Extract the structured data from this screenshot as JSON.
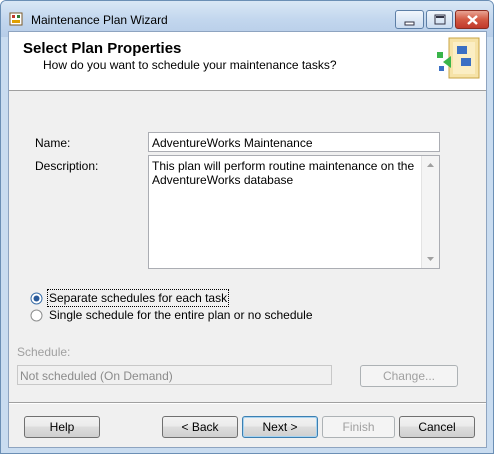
{
  "window": {
    "title": "Maintenance Plan Wizard"
  },
  "header": {
    "title": "Select Plan Properties",
    "subtitle": "How do you want to schedule your maintenance tasks?"
  },
  "form": {
    "name_label": "Name:",
    "name_value": "AdventureWorks Maintenance",
    "description_label": "Description:",
    "description_value": "This plan will perform routine maintenance on the AdventureWorks database"
  },
  "schedule_options": {
    "separate_label": "Separate schedules for each task",
    "single_label": "Single schedule for the entire plan or no schedule",
    "selected": "separate"
  },
  "schedule": {
    "label": "Schedule:",
    "value": "Not scheduled (On Demand)",
    "change_button": "Change..."
  },
  "footer": {
    "help": "Help",
    "back": "< Back",
    "next": "Next >",
    "finish": "Finish",
    "cancel": "Cancel"
  },
  "colors": {
    "titlebar": "#c3d7ee",
    "dialog_bg": "#f0f0f0",
    "close_button": "#c0392b",
    "default_button_border": "#3c7fb1"
  }
}
